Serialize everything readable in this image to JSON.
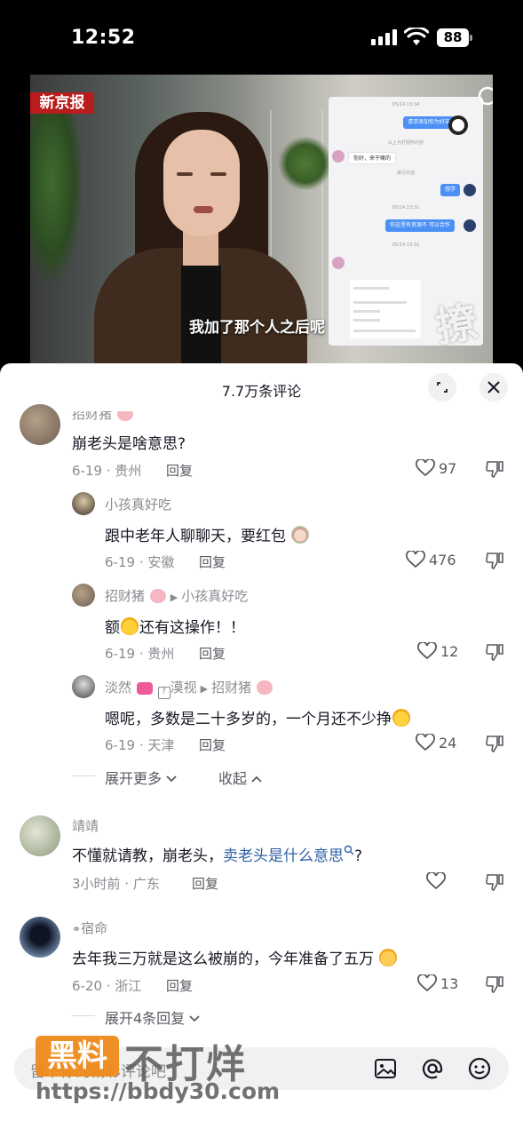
{
  "status_bar": {
    "time": "12:52",
    "battery": "88"
  },
  "video": {
    "logo_text": "新京报",
    "subtitle": "我加了那个人之后呢",
    "chat_screenshot": {
      "bubble1": "请求添加你为好友",
      "greeting": "你好，来干嘛的",
      "bubble2": "想学",
      "bubble3": "你这里有资源不 可以合作",
      "watermark": "撩"
    }
  },
  "panel": {
    "title": "7.7万条评论",
    "comments": [
      {
        "username": "招财猪",
        "text": "崩老头是啥意思?",
        "date": "6-19",
        "location": "贵州",
        "reply": "回复",
        "likes": "97"
      },
      {
        "username": "小孩真好吃",
        "text": "跟中老年人聊聊天，要红包",
        "date": "6-19",
        "location": "安徽",
        "reply": "回复",
        "likes": "476"
      },
      {
        "username": "招财猪",
        "reply_to": "小孩真好吃",
        "text_before": "额",
        "text_after": "还有这操作！！",
        "date": "6-19",
        "location": "贵州",
        "reply": "回复",
        "likes": "12"
      },
      {
        "username": "淡然",
        "tag": "漠视",
        "reply_to": "招财猪",
        "text": "嗯呢，多数是二十多岁的，一个月还不少挣",
        "date": "6-19",
        "location": "天津",
        "reply": "回复",
        "likes": "24"
      },
      {
        "username": "靖靖",
        "text_before": "不懂就请教，崩老头，",
        "text_link": "卖老头是什么意思",
        "text_after": "?",
        "date": "3小时前",
        "location": "广东",
        "reply": "回复",
        "likes": ""
      },
      {
        "username": "宿命",
        "text": "去年我三万就是这么被崩的，今年准备了五万",
        "date": "6-20",
        "location": "浙江",
        "reply": "回复",
        "likes": "13"
      }
    ],
    "expand_more": "展开更多",
    "collapse": "收起",
    "expand_replies": "展开4条回复",
    "input_placeholder": "留下你的精彩评论吧"
  },
  "watermark": {
    "badge": "黑料",
    "text": "不打烊",
    "url": "https://bbdy30.com"
  },
  "colors": {
    "link": "#2f5fa5",
    "watermark_badge": "#f08a1b",
    "news_logo": "#b91c1c"
  }
}
